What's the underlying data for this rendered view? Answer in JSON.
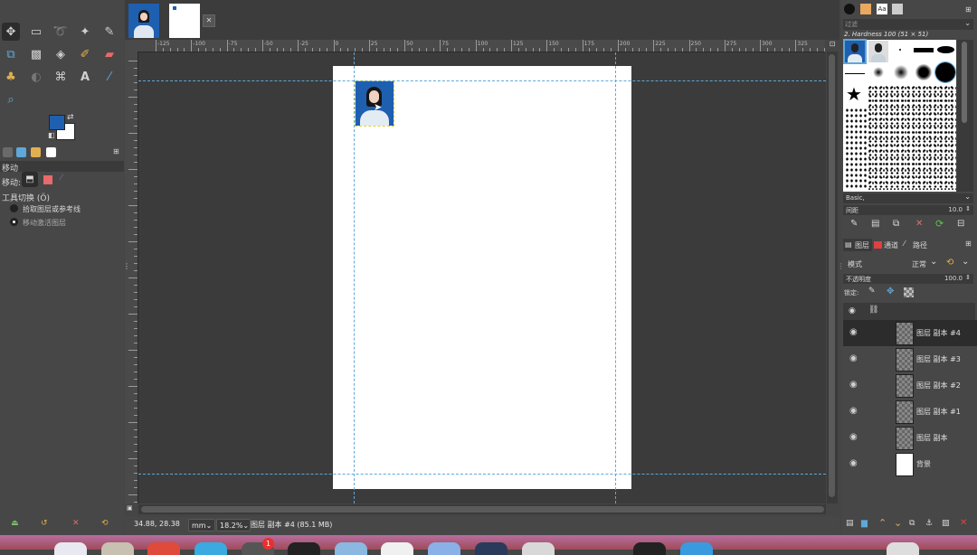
{
  "toolbox": {
    "tools": [
      "move-tool",
      "rect-select-tool",
      "lasso-tool",
      "fuzzy-select-tool",
      "paths-tool",
      "transform-tool",
      "perspective-tool",
      "fill-tool",
      "paintbrush-tool",
      "eraser-tool",
      "clone-tool",
      "heal-tool",
      "warp-tool",
      "text-tool",
      "color-picker-tool",
      "zoom-tool"
    ],
    "fg_color": "#1f5fb0",
    "bg_color": "#ffffff"
  },
  "tool_options": {
    "title": "移动",
    "move_label": "移动:",
    "switch_label": "工具切换 (Ö)",
    "option_pick": "拾取图层或参考线",
    "option_active": "移动激活图层"
  },
  "rulers": {
    "h_labels": [
      "-125",
      "-100",
      "-75",
      "-50",
      "-25",
      "0",
      "25",
      "50",
      "75",
      "100",
      "125",
      "150",
      "175",
      "200",
      "225",
      "250",
      "275",
      "300",
      "325"
    ]
  },
  "status": {
    "coords": "34.88, 28.38",
    "unit": "mm",
    "zoom": "18.2%",
    "layer_info": "图层 副本 #4 (85.1 MB)"
  },
  "brushes": {
    "filter": "过滤",
    "brush_name": "2. Hardness 100 (51 × 51)",
    "preset": "Basic,",
    "spacing_label": "间距",
    "spacing_value": "10.0"
  },
  "layers_panel": {
    "tabs": [
      "图层",
      "通道",
      "路径"
    ],
    "mode_label": "模式",
    "mode_value": "正常",
    "opacity_label": "不透明度",
    "opacity_value": "100.0",
    "lock_label": "锁定:",
    "layers": [
      {
        "name": "图层 副本 #4",
        "active": true
      },
      {
        "name": "图层 副本 #3",
        "active": false
      },
      {
        "name": "图层 副本 #2",
        "active": false
      },
      {
        "name": "图层 副本 #1",
        "active": false
      },
      {
        "name": "图层 副本",
        "active": false
      },
      {
        "name": "背景",
        "active": false
      }
    ]
  },
  "colors": {
    "accent": "#5fa8d8",
    "photo_bg": "#1f5fb0",
    "dock_bar": "#b76ea0"
  },
  "mac_dock": {
    "badge": "1"
  }
}
